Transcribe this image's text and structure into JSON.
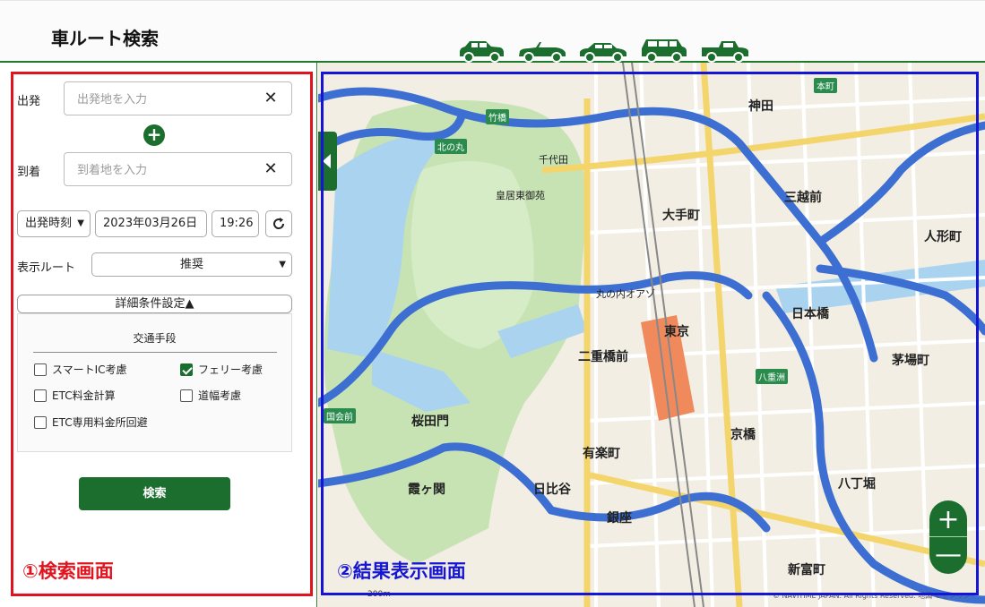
{
  "header": {
    "title": "車ルート検索",
    "vehicles": [
      {
        "icon": "compact-car-icon"
      },
      {
        "icon": "convertible-car-icon"
      },
      {
        "icon": "sedan-car-icon"
      },
      {
        "icon": "suv-car-icon"
      },
      {
        "icon": "pickup-truck-icon"
      }
    ]
  },
  "search": {
    "departure_label": "出発",
    "departure_placeholder": "出発地を入力",
    "arrival_label": "到着",
    "arrival_placeholder": "到着地を入力",
    "clear_symbol": "✕",
    "add_symbol": "+",
    "time_mode": "出発時刻",
    "date": "2023年03月26日",
    "time": "19:26",
    "route_label": "表示ルート",
    "route_value": "推奨",
    "detail_toggle": "詳細条件設定▲",
    "panel_title": "交通手段",
    "options": [
      {
        "label": "スマートIC考慮",
        "checked": false
      },
      {
        "label": "フェリー考慮",
        "checked": true
      },
      {
        "label": "ETC料金計算",
        "checked": false
      },
      {
        "label": "道幅考慮",
        "checked": false
      },
      {
        "label": "ETC専用料金所回避",
        "checked": false
      }
    ],
    "search_button": "検索"
  },
  "annotations": {
    "left": "①検索画面",
    "right": "②結果表示画面"
  },
  "map": {
    "zoom_in": "+",
    "zoom_out": "—",
    "scale": "200m",
    "copyright": "© NAVITIME JAPAN. All Rights Reserved. 地図 ©ゼンリン",
    "labels": {
      "kanda": "神田",
      "otemachi": "大手町",
      "tokyo": "東京",
      "nihonbashi": "日本橋",
      "kyobashi": "京橋",
      "yurakucho": "有楽町",
      "ginza": "銀座",
      "hibiya": "日比谷",
      "kasumigaseki": "霞ヶ関",
      "sakuradamon": "桜田門",
      "hatchobori": "八丁堀",
      "kayabacho": "茅場町",
      "mitsukoshimae": "三越前",
      "shinbashi_tomi": "新富町",
      "ningyocho": "人形町",
      "nijubashimae": "二重橋前",
      "kokyo": "皇居東御苑",
      "kitanomaru": "北の丸",
      "takebashi": "竹橋",
      "honcho": "本町",
      "yaesu": "八重洲",
      "kudanshita": "国会前",
      "tokyo_station": "東京",
      "marunouchi": "丸の内オアゾ",
      "chiyoda": "千代田"
    }
  }
}
